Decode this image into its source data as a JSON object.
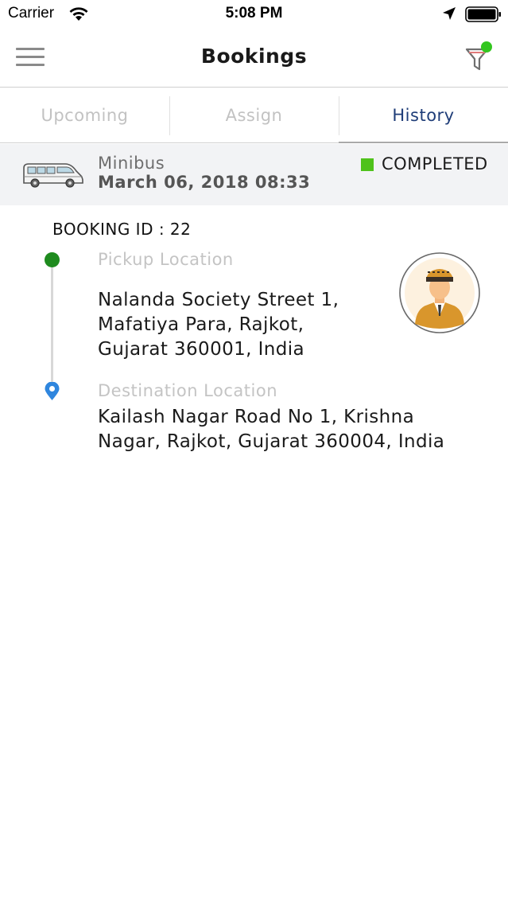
{
  "status_bar": {
    "carrier": "Carrier",
    "time": "5:08 PM"
  },
  "nav": {
    "title": "Bookings",
    "filter_badge_color": "#33c61f"
  },
  "tabs": [
    {
      "label": "Upcoming",
      "active": false
    },
    {
      "label": "Assign",
      "active": false
    },
    {
      "label": "History",
      "active": true
    }
  ],
  "booking": {
    "vehicle_type": "Minibus",
    "date": "March 06, 2018 08:33",
    "status": "COMPLETED",
    "status_color": "#4fc21b",
    "id_label": "BOOKING ID : 22",
    "pickup": {
      "label": "Pickup Location",
      "address_lines": [
        "Nalanda Society Street 1,",
        "Mafatiya Para, Rajkot,",
        "Gujarat 360001, India"
      ]
    },
    "destination": {
      "label": "Destination Location",
      "address_lines": [
        "Kailash Nagar Road No 1, Krishna",
        "Nagar, Rajkot, Gujarat 360004, India"
      ]
    }
  }
}
